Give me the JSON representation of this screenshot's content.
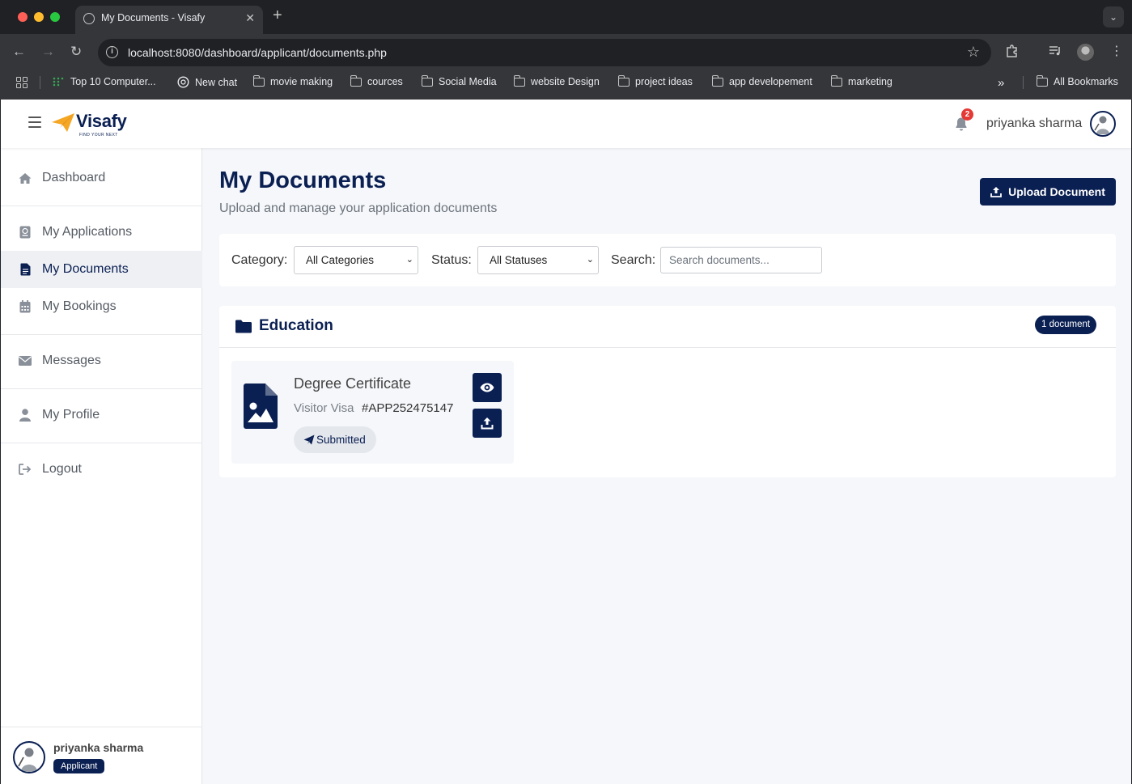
{
  "browser": {
    "tab_title": "My Documents - Visafy",
    "url": "localhost:8080/dashboard/applicant/documents.php",
    "bookmarks": [
      {
        "label": "Top 10 Computer...",
        "icon": "dots-icon"
      },
      {
        "label": "New chat",
        "icon": "chat-icon"
      },
      {
        "label": "movie making",
        "icon": "folder-icon"
      },
      {
        "label": "cources",
        "icon": "folder-icon"
      },
      {
        "label": "Social Media",
        "icon": "folder-icon"
      },
      {
        "label": "website Design",
        "icon": "folder-icon"
      },
      {
        "label": "project ideas",
        "icon": "folder-icon"
      },
      {
        "label": "app developement",
        "icon": "folder-icon"
      },
      {
        "label": "marketing",
        "icon": "folder-icon"
      }
    ],
    "overflow_label": "»",
    "all_bookmarks": "All Bookmarks"
  },
  "header": {
    "brand": "Visafy",
    "tagline": "FIND YOUR NEXT",
    "notification_count": "2",
    "user_name": "priyanka sharma"
  },
  "sidebar": {
    "items": [
      {
        "label": "Dashboard",
        "icon": "home-icon"
      },
      {
        "label": "My Applications",
        "icon": "passport-icon"
      },
      {
        "label": "My Documents",
        "icon": "document-icon",
        "active": true
      },
      {
        "label": "My Bookings",
        "icon": "calendar-icon"
      },
      {
        "label": "Messages",
        "icon": "envelope-icon"
      },
      {
        "label": "My Profile",
        "icon": "user-icon"
      },
      {
        "label": "Logout",
        "icon": "logout-icon"
      }
    ],
    "user": {
      "name": "priyanka sharma",
      "role": "Applicant"
    }
  },
  "page": {
    "title": "My Documents",
    "subtitle": "Upload and manage your application documents",
    "upload_button": "Upload Document"
  },
  "filters": {
    "category_label": "Category:",
    "category_value": "All Categories",
    "status_label": "Status:",
    "status_value": "All Statuses",
    "search_label": "Search:",
    "search_placeholder": "Search documents..."
  },
  "categories": [
    {
      "name": "Education",
      "count_label": "1 document",
      "documents": [
        {
          "name": "Degree Certificate",
          "visa_type": "Visitor Visa",
          "application_ref": "#APP252475147",
          "status": "Submitted"
        }
      ]
    }
  ],
  "colors": {
    "brand_navy": "#0a1f52",
    "badge_red": "#e53935",
    "logo_orange": "#f5a623"
  }
}
